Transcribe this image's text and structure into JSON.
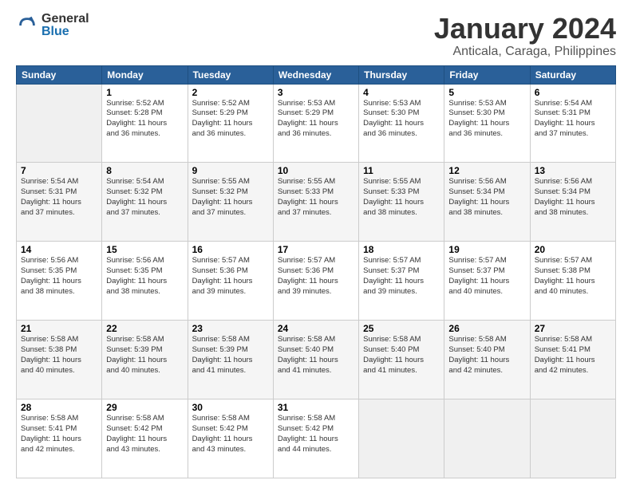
{
  "logo": {
    "general": "General",
    "blue": "Blue"
  },
  "title": "January 2024",
  "subtitle": "Anticala, Caraga, Philippines",
  "days_header": [
    "Sunday",
    "Monday",
    "Tuesday",
    "Wednesday",
    "Thursday",
    "Friday",
    "Saturday"
  ],
  "weeks": [
    [
      {
        "day": "",
        "info": ""
      },
      {
        "day": "1",
        "info": "Sunrise: 5:52 AM\nSunset: 5:28 PM\nDaylight: 11 hours\nand 36 minutes."
      },
      {
        "day": "2",
        "info": "Sunrise: 5:52 AM\nSunset: 5:29 PM\nDaylight: 11 hours\nand 36 minutes."
      },
      {
        "day": "3",
        "info": "Sunrise: 5:53 AM\nSunset: 5:29 PM\nDaylight: 11 hours\nand 36 minutes."
      },
      {
        "day": "4",
        "info": "Sunrise: 5:53 AM\nSunset: 5:30 PM\nDaylight: 11 hours\nand 36 minutes."
      },
      {
        "day": "5",
        "info": "Sunrise: 5:53 AM\nSunset: 5:30 PM\nDaylight: 11 hours\nand 36 minutes."
      },
      {
        "day": "6",
        "info": "Sunrise: 5:54 AM\nSunset: 5:31 PM\nDaylight: 11 hours\nand 37 minutes."
      }
    ],
    [
      {
        "day": "7",
        "info": "Sunrise: 5:54 AM\nSunset: 5:31 PM\nDaylight: 11 hours\nand 37 minutes."
      },
      {
        "day": "8",
        "info": "Sunrise: 5:54 AM\nSunset: 5:32 PM\nDaylight: 11 hours\nand 37 minutes."
      },
      {
        "day": "9",
        "info": "Sunrise: 5:55 AM\nSunset: 5:32 PM\nDaylight: 11 hours\nand 37 minutes."
      },
      {
        "day": "10",
        "info": "Sunrise: 5:55 AM\nSunset: 5:33 PM\nDaylight: 11 hours\nand 37 minutes."
      },
      {
        "day": "11",
        "info": "Sunrise: 5:55 AM\nSunset: 5:33 PM\nDaylight: 11 hours\nand 38 minutes."
      },
      {
        "day": "12",
        "info": "Sunrise: 5:56 AM\nSunset: 5:34 PM\nDaylight: 11 hours\nand 38 minutes."
      },
      {
        "day": "13",
        "info": "Sunrise: 5:56 AM\nSunset: 5:34 PM\nDaylight: 11 hours\nand 38 minutes."
      }
    ],
    [
      {
        "day": "14",
        "info": "Sunrise: 5:56 AM\nSunset: 5:35 PM\nDaylight: 11 hours\nand 38 minutes."
      },
      {
        "day": "15",
        "info": "Sunrise: 5:56 AM\nSunset: 5:35 PM\nDaylight: 11 hours\nand 38 minutes."
      },
      {
        "day": "16",
        "info": "Sunrise: 5:57 AM\nSunset: 5:36 PM\nDaylight: 11 hours\nand 39 minutes."
      },
      {
        "day": "17",
        "info": "Sunrise: 5:57 AM\nSunset: 5:36 PM\nDaylight: 11 hours\nand 39 minutes."
      },
      {
        "day": "18",
        "info": "Sunrise: 5:57 AM\nSunset: 5:37 PM\nDaylight: 11 hours\nand 39 minutes."
      },
      {
        "day": "19",
        "info": "Sunrise: 5:57 AM\nSunset: 5:37 PM\nDaylight: 11 hours\nand 40 minutes."
      },
      {
        "day": "20",
        "info": "Sunrise: 5:57 AM\nSunset: 5:38 PM\nDaylight: 11 hours\nand 40 minutes."
      }
    ],
    [
      {
        "day": "21",
        "info": "Sunrise: 5:58 AM\nSunset: 5:38 PM\nDaylight: 11 hours\nand 40 minutes."
      },
      {
        "day": "22",
        "info": "Sunrise: 5:58 AM\nSunset: 5:39 PM\nDaylight: 11 hours\nand 40 minutes."
      },
      {
        "day": "23",
        "info": "Sunrise: 5:58 AM\nSunset: 5:39 PM\nDaylight: 11 hours\nand 41 minutes."
      },
      {
        "day": "24",
        "info": "Sunrise: 5:58 AM\nSunset: 5:40 PM\nDaylight: 11 hours\nand 41 minutes."
      },
      {
        "day": "25",
        "info": "Sunrise: 5:58 AM\nSunset: 5:40 PM\nDaylight: 11 hours\nand 41 minutes."
      },
      {
        "day": "26",
        "info": "Sunrise: 5:58 AM\nSunset: 5:40 PM\nDaylight: 11 hours\nand 42 minutes."
      },
      {
        "day": "27",
        "info": "Sunrise: 5:58 AM\nSunset: 5:41 PM\nDaylight: 11 hours\nand 42 minutes."
      }
    ],
    [
      {
        "day": "28",
        "info": "Sunrise: 5:58 AM\nSunset: 5:41 PM\nDaylight: 11 hours\nand 42 minutes."
      },
      {
        "day": "29",
        "info": "Sunrise: 5:58 AM\nSunset: 5:42 PM\nDaylight: 11 hours\nand 43 minutes."
      },
      {
        "day": "30",
        "info": "Sunrise: 5:58 AM\nSunset: 5:42 PM\nDaylight: 11 hours\nand 43 minutes."
      },
      {
        "day": "31",
        "info": "Sunrise: 5:58 AM\nSunset: 5:42 PM\nDaylight: 11 hours\nand 44 minutes."
      },
      {
        "day": "",
        "info": ""
      },
      {
        "day": "",
        "info": ""
      },
      {
        "day": "",
        "info": ""
      }
    ]
  ]
}
